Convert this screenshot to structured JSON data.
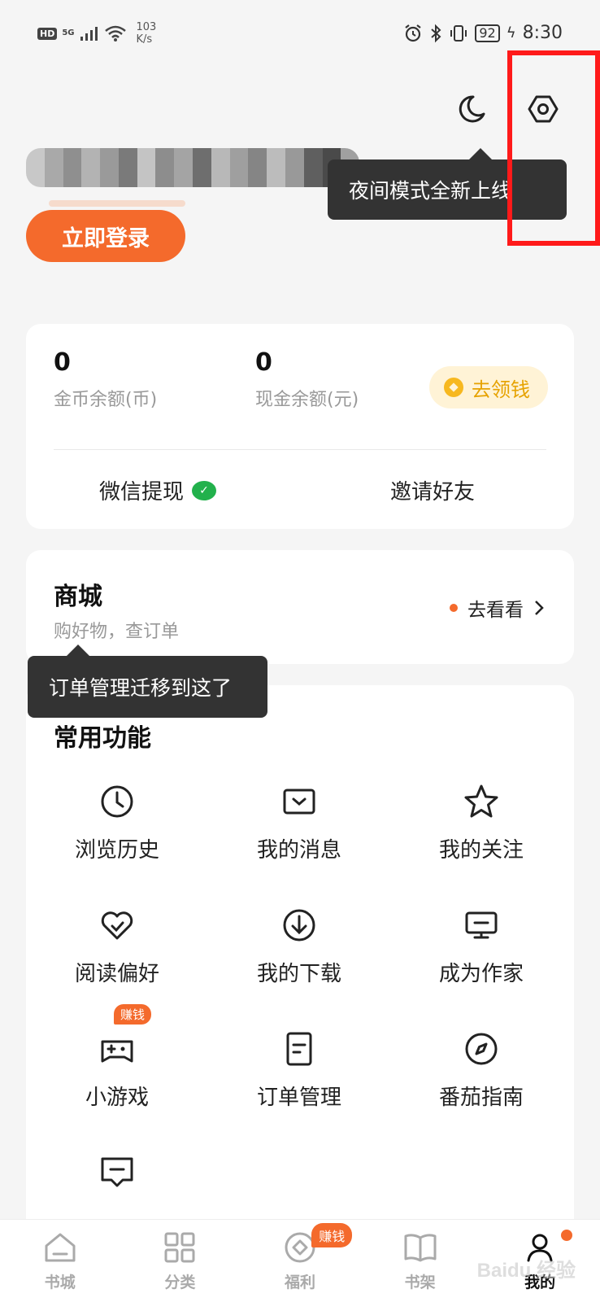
{
  "status_bar": {
    "hd": "HD",
    "network": "5G",
    "speed_value": "103",
    "speed_unit": "K/s",
    "battery": "92",
    "time": "8:30"
  },
  "header": {
    "night_mode_icon": "moon-icon",
    "settings_icon": "hexagon-settings-icon",
    "night_mode_tooltip": "夜间模式全新上线"
  },
  "profile": {
    "login_label": "立即登录"
  },
  "wallet": {
    "coin_balance": "0",
    "coin_label": "金币余额(币)",
    "cash_balance": "0",
    "cash_label": "现金余额(元)",
    "earn_label": "去领钱",
    "withdraw_label": "微信提现",
    "invite_label": "邀请好友"
  },
  "mall": {
    "title": "商城",
    "subtitle": "购好物，查订单",
    "go_label": "去看看",
    "tooltip": "订单管理迁移到这了"
  },
  "functions": {
    "title": "常用功能",
    "items": [
      {
        "label": "浏览历史",
        "icon": "clock-icon"
      },
      {
        "label": "我的消息",
        "icon": "message-icon"
      },
      {
        "label": "我的关注",
        "icon": "star-icon"
      },
      {
        "label": "阅读偏好",
        "icon": "heart-check-icon"
      },
      {
        "label": "我的下载",
        "icon": "download-icon"
      },
      {
        "label": "成为作家",
        "icon": "monitor-icon"
      },
      {
        "label": "小游戏",
        "icon": "gamepad-icon",
        "badge": "赚钱"
      },
      {
        "label": "订单管理",
        "icon": "document-icon"
      },
      {
        "label": "番茄指南",
        "icon": "compass-icon"
      },
      {
        "label": "",
        "icon": "feedback-icon"
      }
    ]
  },
  "bottom_nav": {
    "items": [
      {
        "label": "书城",
        "icon": "home-icon"
      },
      {
        "label": "分类",
        "icon": "grid-icon"
      },
      {
        "label": "福利",
        "icon": "coin-icon",
        "badge": "赚钱"
      },
      {
        "label": "书架",
        "icon": "book-icon"
      },
      {
        "label": "我的",
        "icon": "profile-icon",
        "active": true
      }
    ]
  },
  "watermark": "Baidu 经验",
  "colors": {
    "accent": "#f46a2c",
    "highlight": "#ff1a1a",
    "tooltip_bg": "#333333"
  }
}
